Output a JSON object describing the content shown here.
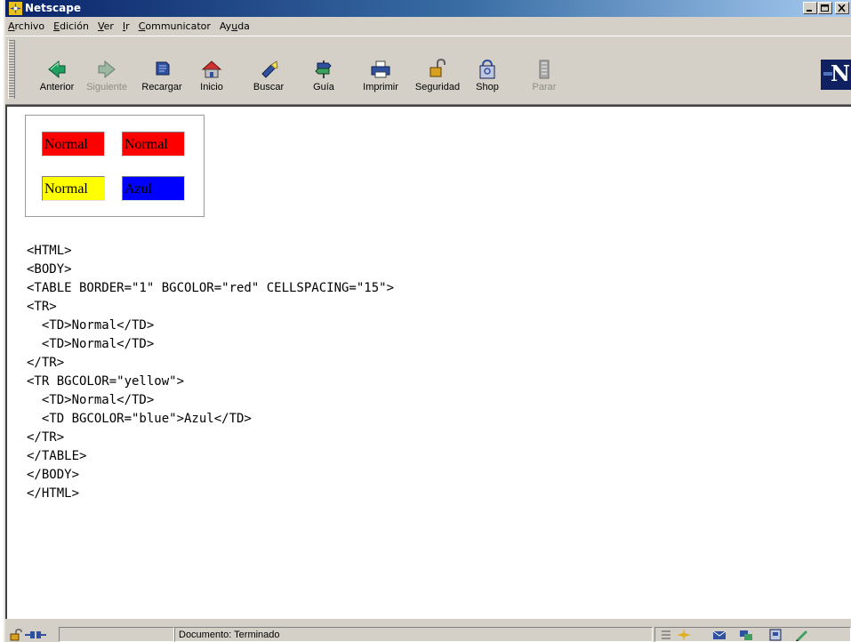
{
  "window": {
    "title": "Netscape"
  },
  "menu": [
    {
      "pre": "",
      "u": "A",
      "post": "rchivo"
    },
    {
      "pre": "",
      "u": "E",
      "post": "dición"
    },
    {
      "pre": "",
      "u": "V",
      "post": "er"
    },
    {
      "pre": "",
      "u": "I",
      "post": "r"
    },
    {
      "pre": "",
      "u": "C",
      "post": "ommunicator"
    },
    {
      "pre": "Ay",
      "u": "u",
      "post": "da"
    }
  ],
  "toolbar": {
    "back": "Anterior",
    "forward": "Siguiente",
    "reload": "Recargar",
    "home": "Inicio",
    "search": "Buscar",
    "guide": "Guía",
    "print": "Imprimir",
    "security": "Seguridad",
    "shop": "Shop",
    "stop": "Parar"
  },
  "logo": "N",
  "demo_table": {
    "row1": [
      "Normal",
      "Normal"
    ],
    "row2": [
      "Normal",
      "Azul"
    ],
    "colors": {
      "table": "#ff0000",
      "row2": "#ffff00",
      "blue_cell": "#0000ff"
    }
  },
  "source_code": [
    "<HTML>",
    "<BODY>",
    "<TABLE BORDER=\"1\" BGCOLOR=\"red\" CELLSPACING=\"15\">",
    "<TR>",
    "  <TD>Normal</TD>",
    "  <TD>Normal</TD>",
    "</TR>",
    "<TR BGCOLOR=\"yellow\">",
    "  <TD>Normal</TD>",
    "  <TD BGCOLOR=\"blue\">Azul</TD>",
    "</TR>",
    "</TABLE>",
    "</BODY>",
    "</HTML>"
  ],
  "status": {
    "text": "Documento: Terminado"
  }
}
